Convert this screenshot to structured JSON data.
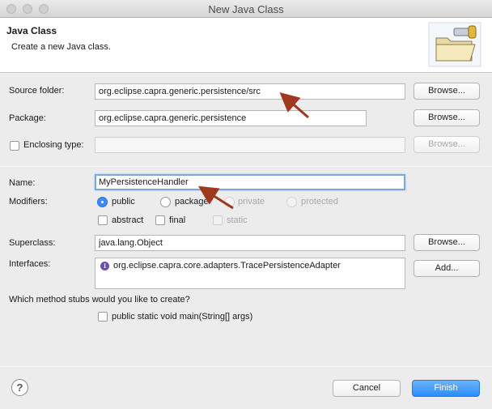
{
  "window": {
    "title": "New Java Class"
  },
  "header": {
    "title": "Java Class",
    "description": "Create a new Java class."
  },
  "source_folder": {
    "label": "Source folder:",
    "value": "org.eclipse.capra.generic.persistence/src",
    "button": "Browse..."
  },
  "package": {
    "label": "Package:",
    "value": "org.eclipse.capra.generic.persistence",
    "button": "Browse..."
  },
  "enclosing": {
    "label": "Enclosing type:",
    "value": "",
    "button": "Browse..."
  },
  "name": {
    "label": "Name:",
    "value": "MyPersistenceHandler"
  },
  "modifiers": {
    "label": "Modifiers:",
    "public": "public",
    "package": "package",
    "private": "private",
    "protected": "protected",
    "abstract": "abstract",
    "final": "final",
    "static": "static",
    "selected": "public"
  },
  "superclass": {
    "label": "Superclass:",
    "value": "java.lang.Object",
    "button": "Browse..."
  },
  "interfaces": {
    "label": "Interfaces:",
    "items": [
      "org.eclipse.capra.core.adapters.TracePersistenceAdapter"
    ],
    "button": "Add..."
  },
  "stubs": {
    "question": "Which method stubs would you like to create?",
    "main": "public static void main(String[] args)"
  },
  "footer": {
    "help": "?",
    "cancel": "Cancel",
    "finish": "Finish"
  },
  "annotation_color": "#a0381f",
  "icons": [
    "wizard-folder-icon",
    "interface-icon",
    "help-icon",
    "annotation-arrow"
  ]
}
